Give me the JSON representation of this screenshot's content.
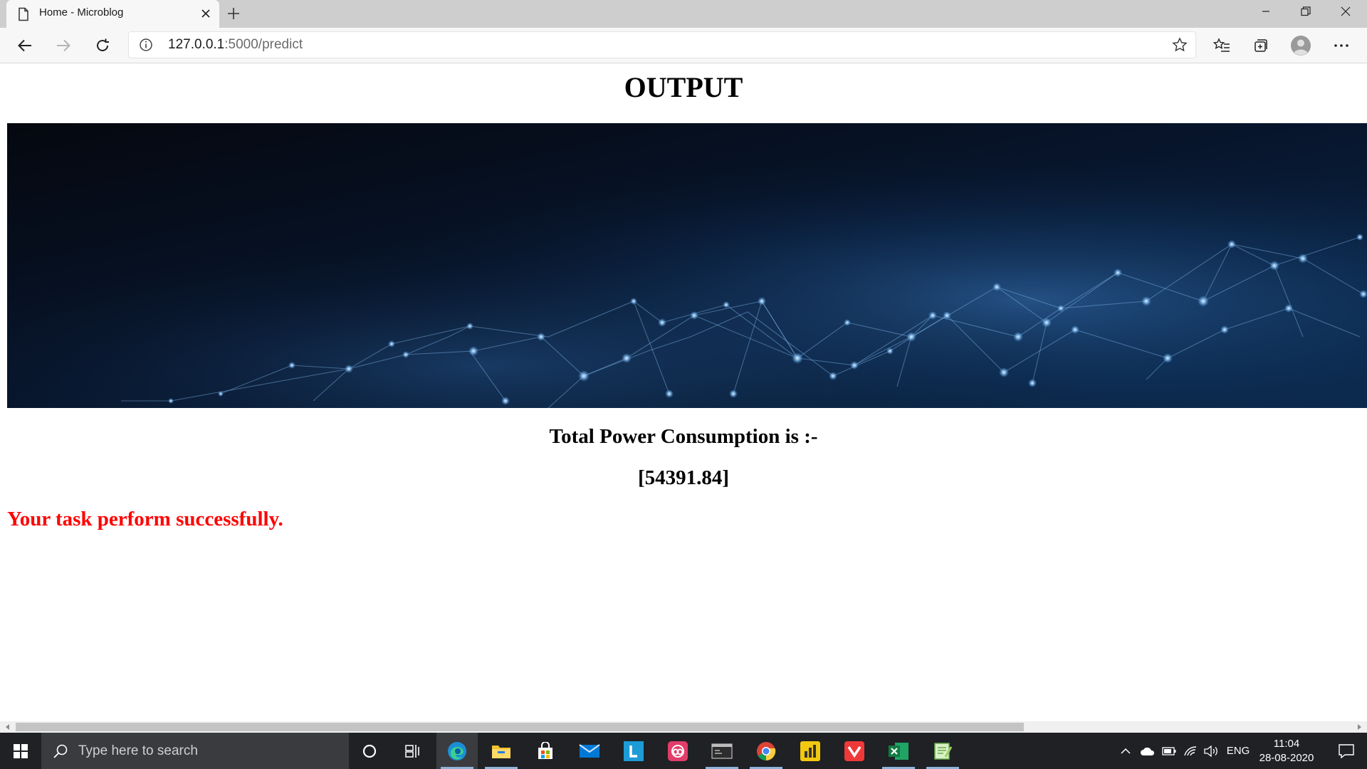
{
  "browser": {
    "tab_title": "Home - Microblog",
    "url_host": "127.0.0.1",
    "url_path": ":5000/predict"
  },
  "page": {
    "heading": "OUTPUT",
    "result_label": "Total Power Consumption is :-",
    "result_value": "[54391.84]",
    "status_message": "Your task perform successfully."
  },
  "colors": {
    "message": "#ff0000",
    "banner_dark": "#06101e",
    "banner_glow": "#5aa0e6"
  },
  "taskbar": {
    "search_placeholder": "Type here to search",
    "pinned": [
      "cortana-icon",
      "task-view-icon",
      "edge-icon",
      "file-explorer-icon",
      "store-icon",
      "mail-icon",
      "l-app-icon",
      "creative-cloud-icon",
      "terminal-icon",
      "chrome-icon",
      "power-bi-icon",
      "vivaldi-icon",
      "excel-icon",
      "notepad-plus-icon"
    ],
    "language": "ENG",
    "time": "11:04",
    "date": "28-08-2020"
  }
}
